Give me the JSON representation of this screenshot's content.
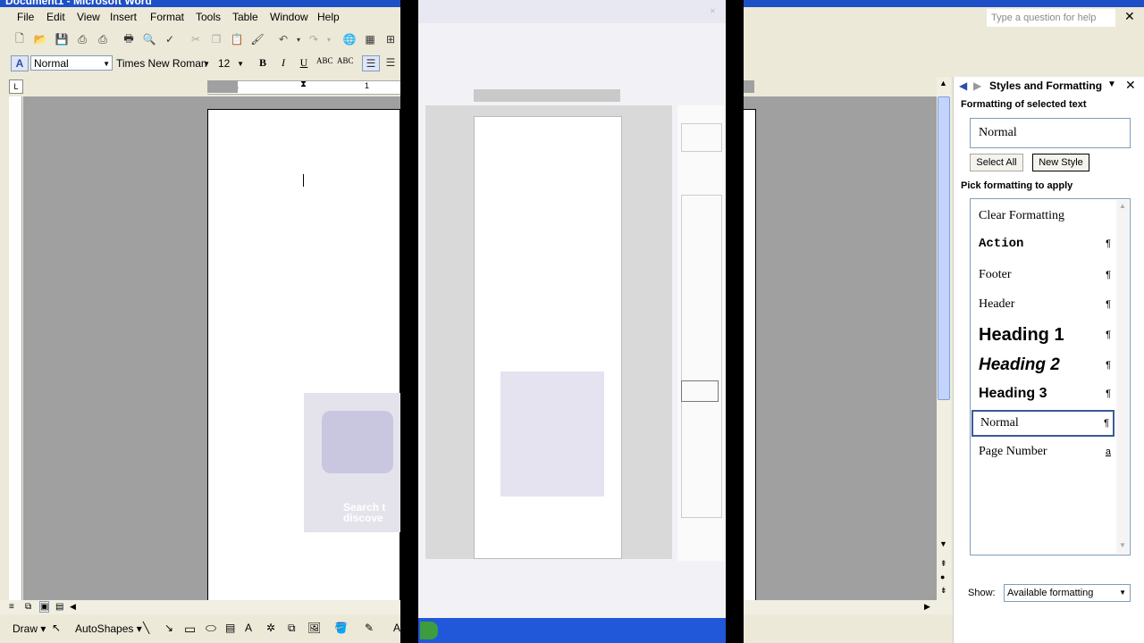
{
  "app": {
    "title": "Document1 - Microsoft Word"
  },
  "menu": [
    "File",
    "Edit",
    "View",
    "Insert",
    "Format",
    "Tools",
    "Table",
    "Window",
    "Help"
  ],
  "help_box": {
    "placeholder": "Type a question for help"
  },
  "formatting_toolbar": {
    "style": "Normal",
    "font": "Times New Roman",
    "size": "12"
  },
  "icons": {
    "standard_toolbar": [
      "new-icon",
      "open-icon",
      "save-icon",
      "permission-icon",
      "print-icon",
      "print-preview-icon",
      "spelling-icon",
      "cut-icon",
      "copy-icon",
      "paste-icon",
      "format-painter-icon",
      "undo-icon",
      "redo-icon",
      "hyperlink-icon",
      "tables-icon"
    ],
    "formatting_toolbar": [
      "styles-icon",
      "bold-icon",
      "italic-icon",
      "underline-icon",
      "align-left-icon",
      "align-center-icon"
    ]
  },
  "ruler": {
    "mark": "1"
  },
  "watermark": {
    "line1": "Search t",
    "line2": "discove"
  },
  "task_pane": {
    "title": "Styles and Formatting",
    "formatting_selected_title": "Formatting of selected text",
    "selected_formatting": "Normal",
    "select_all_label": "Select All",
    "new_style_label": "New Style",
    "pick_title": "Pick formatting to apply",
    "styles": [
      {
        "name": "Clear Formatting",
        "mark": ""
      },
      {
        "name": "Action",
        "mark": "¶"
      },
      {
        "name": "Footer",
        "mark": "¶"
      },
      {
        "name": "Header",
        "mark": "¶"
      },
      {
        "name": "Heading 1",
        "mark": "¶"
      },
      {
        "name": "Heading 2",
        "mark": "¶"
      },
      {
        "name": "Heading 3",
        "mark": "¶"
      },
      {
        "name": "Normal",
        "mark": "¶"
      },
      {
        "name": "Page Number",
        "mark": "a"
      }
    ],
    "show_label": "Show:",
    "show_value": "Available formatting"
  },
  "draw_toolbar": {
    "draw_label": "Draw",
    "autoshapes_label": "AutoShapes"
  }
}
